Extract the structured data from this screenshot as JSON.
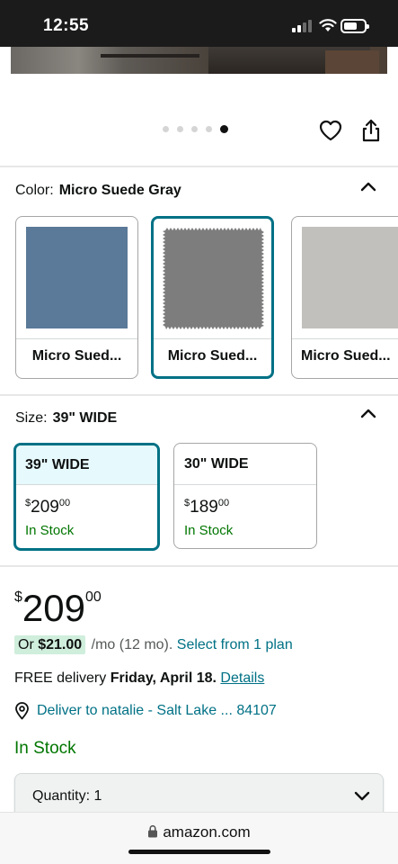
{
  "status_bar": {
    "time": "12:55"
  },
  "gallery": {
    "dot_count": 5,
    "active_dot_index": 4
  },
  "color_section": {
    "label": "Color:",
    "selected_value": "Micro Suede Gray",
    "options": [
      {
        "name": "Micro Sued...",
        "swatch_color": "#5b7998",
        "selected": false
      },
      {
        "name": "Micro Sued...",
        "swatch_color": "#7d7d7d",
        "selected": true
      },
      {
        "name": "Micro Sued...",
        "swatch_color": "#c2c0bc",
        "selected": false
      }
    ]
  },
  "size_section": {
    "label": "Size:",
    "selected_value": "39\" WIDE",
    "options": [
      {
        "name": "39\" WIDE",
        "currency": "$",
        "price_whole": "209",
        "price_fraction": "00",
        "stock": "In Stock",
        "selected": true
      },
      {
        "name": "30\" WIDE",
        "currency": "$",
        "price_whole": "189",
        "price_fraction": "00",
        "stock": "In Stock",
        "selected": false
      }
    ]
  },
  "price": {
    "currency": "$",
    "whole": "209",
    "fraction": "00"
  },
  "monthly": {
    "or_label": "Or",
    "amount": "$21.00",
    "term": "/mo (12 mo).",
    "plan_link": "Select from 1 plan"
  },
  "delivery": {
    "prefix": "FREE delivery",
    "date": "Friday, April 18.",
    "details_link": "Details"
  },
  "deliver_to": "Deliver to natalie - Salt Lake ... 84107",
  "availability": "In Stock",
  "quantity": {
    "label": "Quantity:",
    "value": "1"
  },
  "browser": {
    "url": "amazon.com"
  },
  "colors": {
    "teal_accent": "#007185",
    "stock_green": "#007600",
    "selected_bg": "#e6f9fc",
    "installment_badge": "#cfeedc"
  }
}
